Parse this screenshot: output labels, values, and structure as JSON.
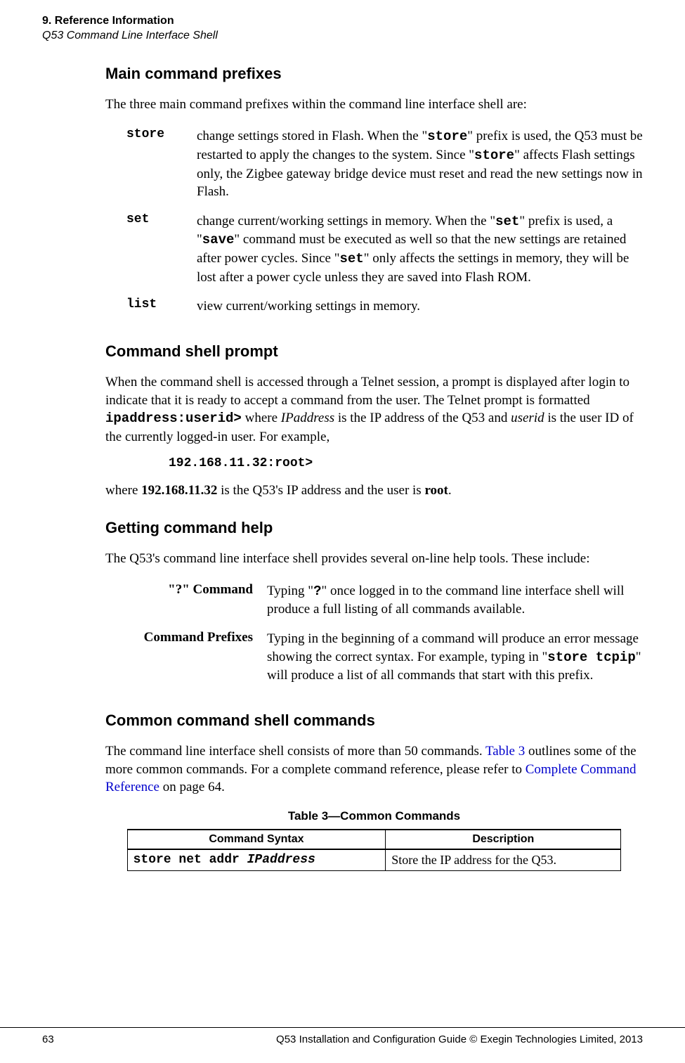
{
  "running_head": {
    "line1": "9. Reference Information",
    "line2": "Q53 Command Line Interface Shell"
  },
  "sections": {
    "main_prefixes": {
      "heading": "Main command prefixes",
      "intro": "The three main command prefixes within the command line interface shell are:",
      "items": [
        {
          "term": "store",
          "desc_pre": "change settings stored in Flash. When the \"",
          "desc_code1": "store",
          "desc_mid1": "\" prefix is used, the Q53 must be restarted to apply the changes to the system. Since \"",
          "desc_code2": "store",
          "desc_post": "\" affects Flash settings only, the Zigbee gateway bridge device must reset and read the new settings now in Flash."
        },
        {
          "term": "set",
          "desc_pre": "change current/working settings in memory. When the \"",
          "desc_code1": "set",
          "desc_mid1": "\" prefix is used, a \"",
          "desc_code2": "save",
          "desc_mid2": "\" command must be executed as well so that the new settings are retained after power cycles. Since \"",
          "desc_code3": "set",
          "desc_post": "\" only affects the settings in memory, they will be lost after a power cycle unless they are saved into Flash ROM."
        },
        {
          "term": "list",
          "desc": "view current/working settings in memory."
        }
      ]
    },
    "shell_prompt": {
      "heading": "Command shell prompt",
      "para_pre": "When the command shell is accessed through a Telnet session, a prompt is displayed after login to indicate that it is ready to accept a command from the user. The Telnet prompt is formatted ",
      "para_code": "ipaddress:userid>",
      "para_mid": " where ",
      "para_ital1": "IPaddress",
      "para_mid2": " is the IP address of the Q53 and ",
      "para_ital2": "userid",
      "para_post": " is the user ID of the currently logged-in user. For example,",
      "prompt_example": "192.168.11.32:root>",
      "para2_pre": "where ",
      "para2_bold1": "192.168.11.32",
      "para2_mid": " is the Q53's IP address and the user is ",
      "para2_bold2": "root",
      "para2_post": "."
    },
    "getting_help": {
      "heading": "Getting command help",
      "intro": "The Q53's command line interface shell provides several on-line help tools. These include:",
      "items": [
        {
          "term": "\"?\" Command",
          "desc_pre": "Typing \"",
          "desc_code": "?",
          "desc_post": "\" once logged in to the command line interface shell will produce a full listing of all commands available."
        },
        {
          "term": "Command Prefixes",
          "desc_pre": "Typing in the beginning of a command will produce an error message showing the correct syntax. For example, typing in \"",
          "desc_code": "store tcpip",
          "desc_post": "\" will produce a list of all commands that start with this prefix."
        }
      ]
    },
    "common_cmds": {
      "heading": "Common command shell commands",
      "para_pre": "The command line interface shell consists of more than 50 commands. ",
      "para_link1": "Table 3",
      "para_mid": " outlines some of the more common commands. For a complete command reference, please refer to ",
      "para_link2": "Complete Command Reference",
      "para_post": " on page 64.",
      "table_caption": "Table 3—Common Commands",
      "table_headers": {
        "syntax": "Command Syntax",
        "desc": "Description"
      },
      "table_rows": [
        {
          "syntax_cmd": "store net addr ",
          "syntax_param": "IPaddress",
          "desc": "Store the IP address for the Q53."
        }
      ]
    }
  },
  "footer": {
    "page_num": "63",
    "text": "Q53 Installation and Configuration Guide  © Exegin Technologies Limited, 2013"
  }
}
